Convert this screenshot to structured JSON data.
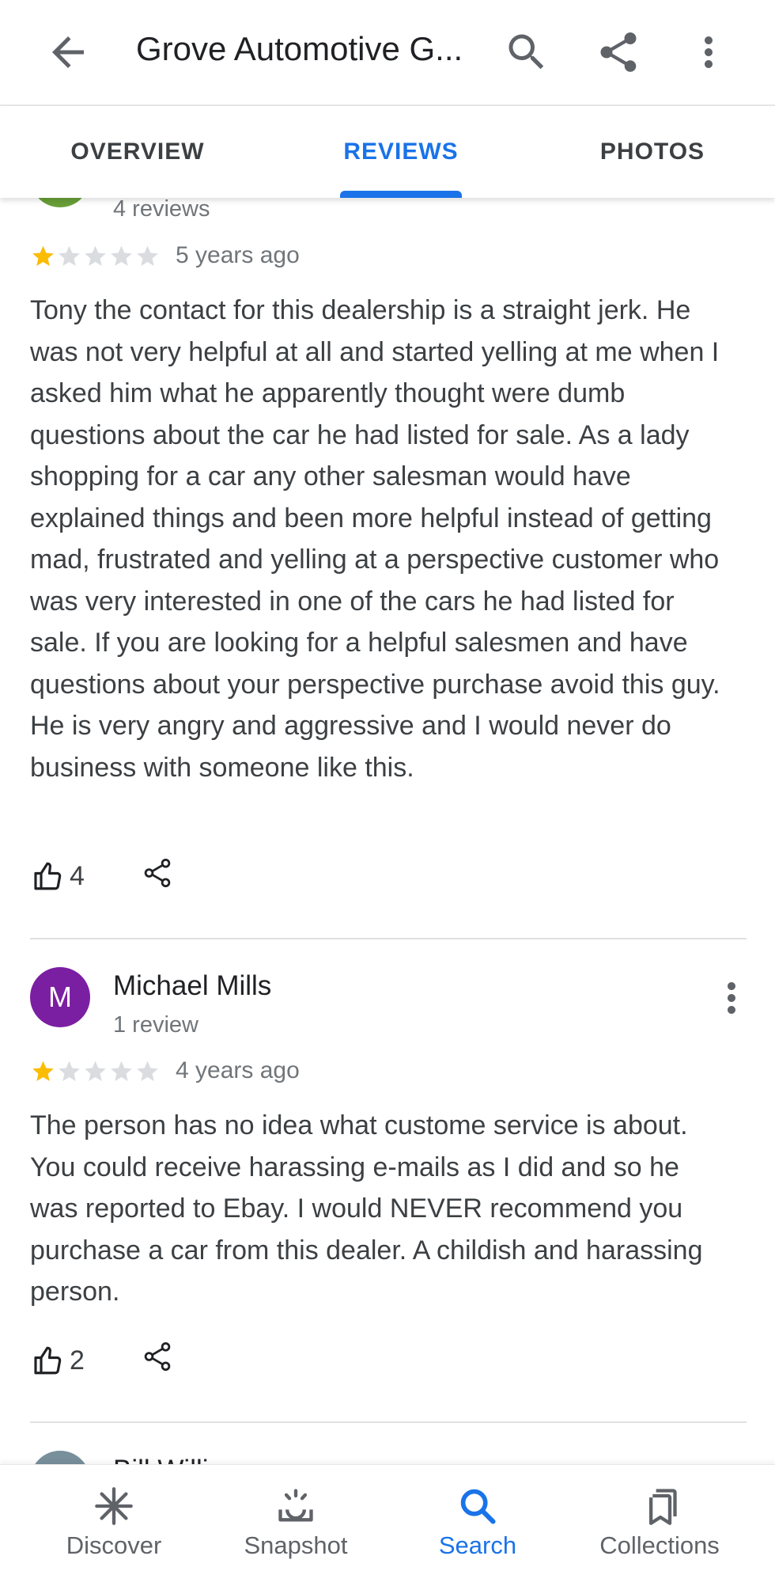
{
  "appbar": {
    "title": "Grove Automotive G...",
    "back_icon": "arrow-back-icon",
    "actions": [
      "search-icon",
      "share-icon",
      "more-vert-icon"
    ]
  },
  "tabs": [
    {
      "label": "OVERVIEW",
      "active": false
    },
    {
      "label": "REVIEWS",
      "active": true
    },
    {
      "label": "PHOTOS",
      "active": false
    }
  ],
  "colors": {
    "accent": "#1a73e8",
    "star_filled": "#fbbc04",
    "star_empty": "#dadce0",
    "avatar_michael": "#7b1fa2",
    "avatar_partial_top": "#689f38",
    "avatar_partial_bottom": "#78909c"
  },
  "reviews": [
    {
      "review_count": "4 reviews",
      "rating": 1,
      "time": "5 years ago",
      "text": "Tony the contact for this dealership is a straight jerk. He was not very helpful at all and started yelling at me when I asked him what he apparently thought were dumb questions about the car he had listed for sale.  As a lady shopping for a car any other salesman would have explained things and been more helpful instead of getting mad, frustrated and yelling at a perspective customer who was very interested in one of the cars he had listed for sale. If you are looking for a helpful salesmen and have questions about your perspective purchase avoid this guy. He is very angry and aggressive and I would never do business with someone like this.",
      "likes": "4"
    },
    {
      "avatar_letter": "M",
      "name": "Michael Mills",
      "review_count": "1 review",
      "rating": 1,
      "time": "4 years ago",
      "text": "The person has no idea what custome service is about. You could receive harassing e-mails as I did and so he was reported to Ebay. I would NEVER recommend you purchase a car from this dealer. A childish and harassing person.",
      "likes": "2"
    },
    {
      "name_partial": "Bill Willi..."
    }
  ],
  "bottom_nav": [
    {
      "label": "Discover",
      "icon": "discover-asterisk-icon",
      "active": false
    },
    {
      "label": "Snapshot",
      "icon": "snapshot-icon",
      "active": false
    },
    {
      "label": "Search",
      "icon": "search-icon",
      "active": true
    },
    {
      "label": "Collections",
      "icon": "bookmarks-icon",
      "active": false
    }
  ]
}
